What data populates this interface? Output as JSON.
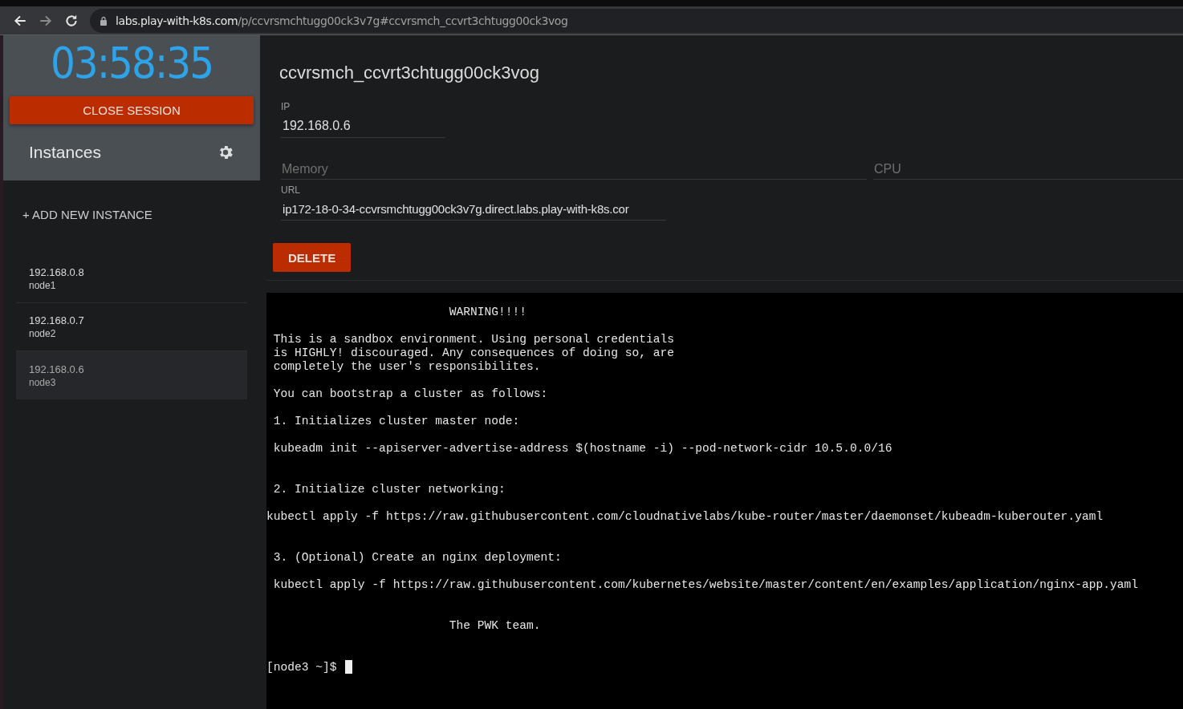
{
  "browser": {
    "url_host": "labs.play-with-k8s.com",
    "url_path": "/p/ccvrsmchtugg00ck3v7g#ccvrsmch_ccvrt3chtugg00ck3vog"
  },
  "sidebar": {
    "timer": "03:58:35",
    "close_button": "CLOSE SESSION",
    "instances_title": "Instances",
    "add_button": "+ ADD NEW INSTANCE",
    "instances": [
      {
        "ip": "192.168.0.8",
        "name": "node1",
        "selected": false
      },
      {
        "ip": "192.168.0.7",
        "name": "node2",
        "selected": false
      },
      {
        "ip": "192.168.0.6",
        "name": "node3",
        "selected": true
      }
    ]
  },
  "details": {
    "title": "ccvrsmch_ccvrt3chtugg00ck3vog",
    "ip_label": "IP",
    "ip_value": "192.168.0.6",
    "memory_placeholder": "Memory",
    "cpu_placeholder": "CPU",
    "url_label": "URL",
    "url_value": "ip172-18-0-34-ccvrsmchtugg00ck3v7g.direct.labs.play-with-k8s.cor",
    "delete_button": "DELETE"
  },
  "terminal": {
    "output": "                          WARNING!!!!\n\n This is a sandbox environment. Using personal credentials\n is HIGHLY! discouraged. Any consequences of doing so, are\n completely the user's responsibilites.\n\n You can bootstrap a cluster as follows:\n\n 1. Initializes cluster master node:\n\n kubeadm init --apiserver-advertise-address $(hostname -i) --pod-network-cidr 10.5.0.0/16\n\n\n 2. Initialize cluster networking:\n\nkubectl apply -f https://raw.githubusercontent.com/cloudnativelabs/kube-router/master/daemonset/kubeadm-kuberouter.yaml\n\n\n 3. (Optional) Create an nginx deployment:\n\n kubectl apply -f https://raw.githubusercontent.com/kubernetes/website/master/content/en/examples/application/nginx-app.yaml\n\n\n                          The PWK team.\n\n\n",
    "prompt": "[node3 ~]$"
  }
}
